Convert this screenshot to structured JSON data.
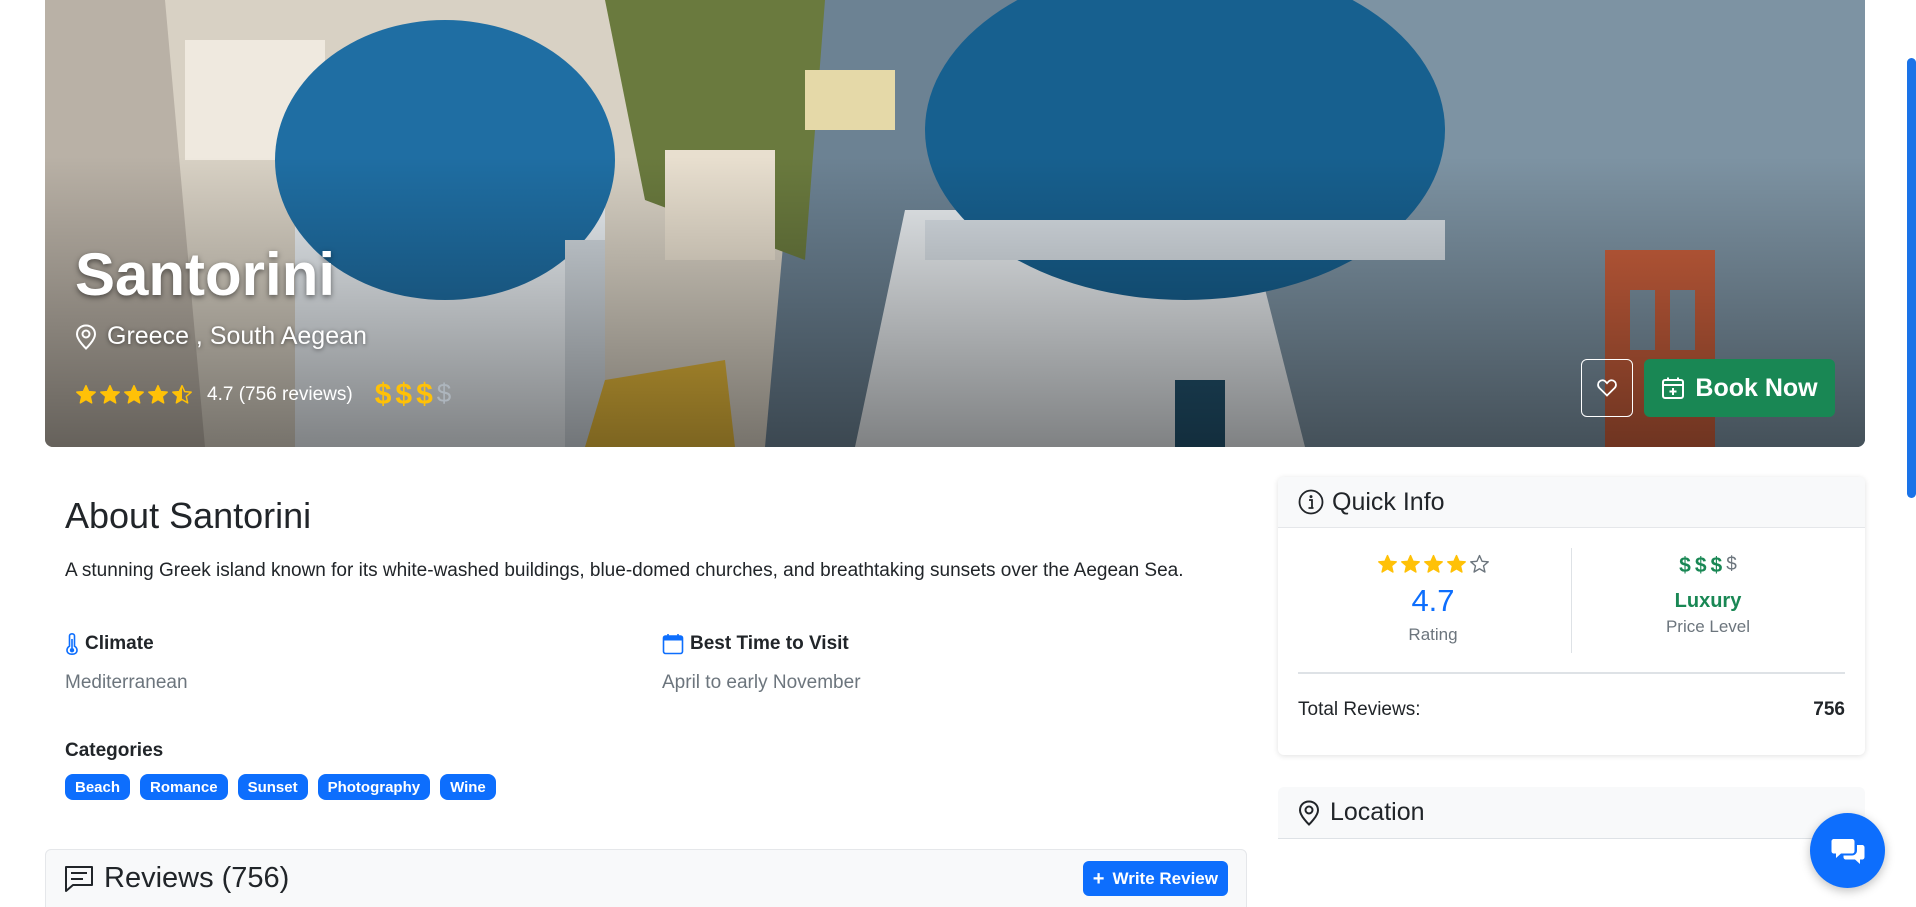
{
  "destination": {
    "title": "Santorini",
    "location": "Greece , South Aegean",
    "rating_text": "4.7 (756 reviews)",
    "star_rating": 4.5,
    "price_level": 3,
    "price_max": 4,
    "price_symbol": "$"
  },
  "actions": {
    "book_label": "Book Now",
    "favorite_icon": "heart-icon"
  },
  "about": {
    "heading": "About Santorini",
    "description": "A stunning Greek island known for its white-washed buildings, blue-domed churches, and breathtaking sunsets over the Aegean Sea.",
    "climate_label": "Climate",
    "climate_value": "Mediterranean",
    "best_time_label": "Best Time to Visit",
    "best_time_value": "April to early November",
    "categories_label": "Categories",
    "categories": [
      "Beach",
      "Romance",
      "Sunset",
      "Photography",
      "Wine"
    ]
  },
  "reviews": {
    "heading": "Reviews (756)",
    "write_label": "Write Review"
  },
  "quick_info": {
    "heading": "Quick Info",
    "star_rating": 4,
    "rating_value": "4.7",
    "rating_label": "Rating",
    "price_level": 3,
    "price_max": 4,
    "price_symbol": "$",
    "price_level_name": "Luxury",
    "price_label": "Price Level",
    "total_reviews_label": "Total Reviews:",
    "total_reviews_value": "756"
  },
  "location_panel": {
    "heading": "Location"
  },
  "colors": {
    "primary": "#0d6efd",
    "success": "#198754",
    "star": "#ffc107",
    "muted": "#6c757d"
  }
}
